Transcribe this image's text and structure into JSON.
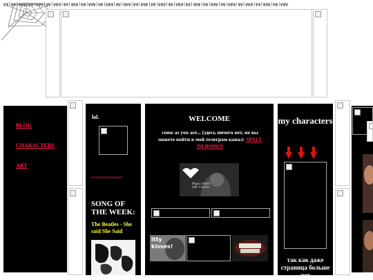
{
  "ticker": "ψψ|ψψ|ψψψ|ψψ|ψψψ|ψψ|ψψψ|ψψ|ψψψ|ψψ|ψψψ|ψψ|ψψψ|ψψ|ψψψ|ψψ|ψψψ|ψψ|ψψψ|ψψ|ψψψ|ψψ|ψψψ|ψψ|ψψψ|ψψ|ψψψ|ψψ|ψψψ|ψψ|ψψψ|ψψ|ψψψ",
  "nav": {
    "blog": "BLOG",
    "characters": "CHARACTERS",
    "art": "ART"
  },
  "left": {
    "lol": "lol.",
    "pinkline": "ннннннннннннннннн",
    "song_heading": "SONG OF THE WEEK:",
    "song_title": "The Beatles - She said She Said"
  },
  "center": {
    "title": "WELCOME",
    "text_before_link": "come as you are... (здесь ничего нет, но вы можете войти в мой телеграм-канал: ",
    "link": "SPALT IM BODEN",
    "gif_caption": "Music Heals Our Cracks",
    "kiss_text": "itty kisses!"
  },
  "right": {
    "title": "my characters",
    "bottom_text": "так как даже страница больше нет"
  },
  "colors": {
    "accent": "#ff1a4a",
    "song_title": "#ffff33",
    "arrow": "#e01010"
  }
}
